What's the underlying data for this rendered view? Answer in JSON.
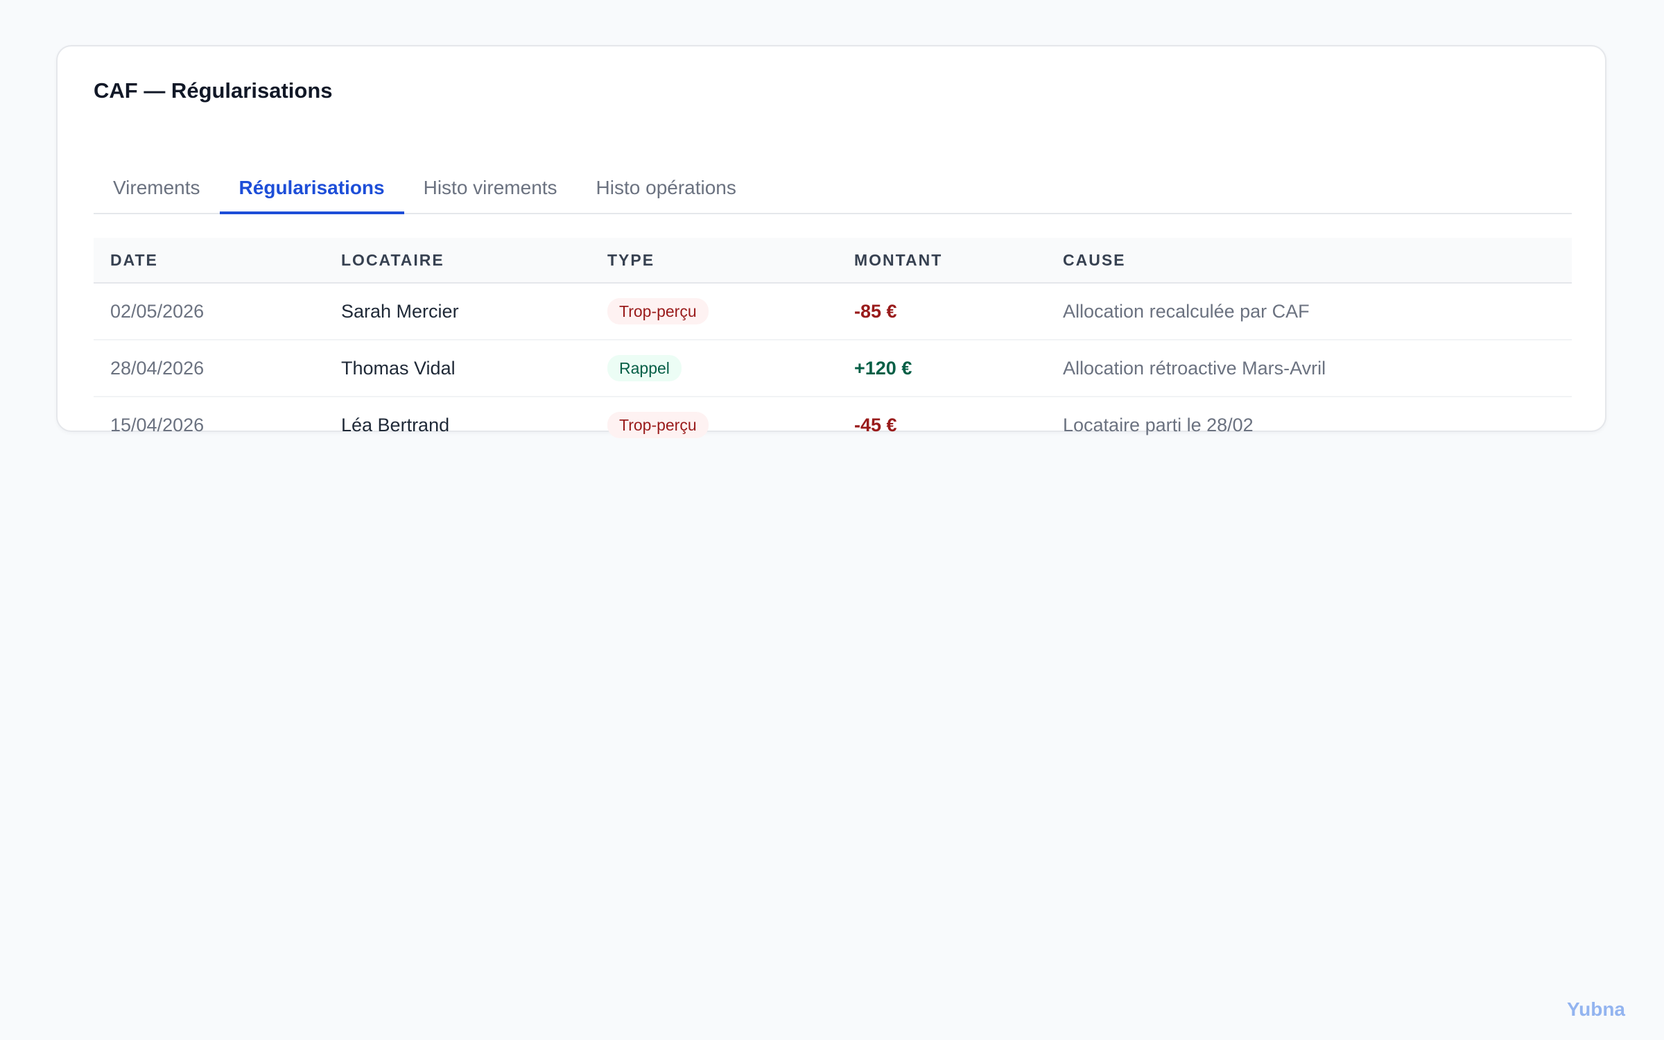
{
  "card": {
    "title": "CAF — Régularisations"
  },
  "tabs": [
    {
      "label": "Virements",
      "active": false
    },
    {
      "label": "Régularisations",
      "active": true
    },
    {
      "label": "Histo virements",
      "active": false
    },
    {
      "label": "Histo opérations",
      "active": false
    }
  ],
  "table": {
    "headers": {
      "date": "DATE",
      "tenant": "LOCATAIRE",
      "type": "TYPE",
      "amount": "MONTANT",
      "cause": "CAUSE"
    },
    "rows": [
      {
        "date": "02/05/2026",
        "tenant": "Sarah Mercier",
        "type": "Trop-perçu",
        "amount": "-85 €",
        "cause": "Allocation recalculée par CAF"
      },
      {
        "date": "28/04/2026",
        "tenant": "Thomas Vidal",
        "type": "Rappel",
        "amount": "+120 €",
        "cause": "Allocation rétroactive Mars-Avril"
      },
      {
        "date": "15/04/2026",
        "tenant": "Léa Bertrand",
        "type": "Trop-perçu",
        "amount": "-45 €",
        "cause": "Locataire parti le 28/02"
      }
    ]
  },
  "colors": {
    "accent": "#1d4ed8",
    "negative": "#991b1b",
    "negative_bg": "#fef2f2",
    "positive": "#065f46",
    "positive_bg": "#ecfdf5"
  },
  "brand": "Yubna"
}
